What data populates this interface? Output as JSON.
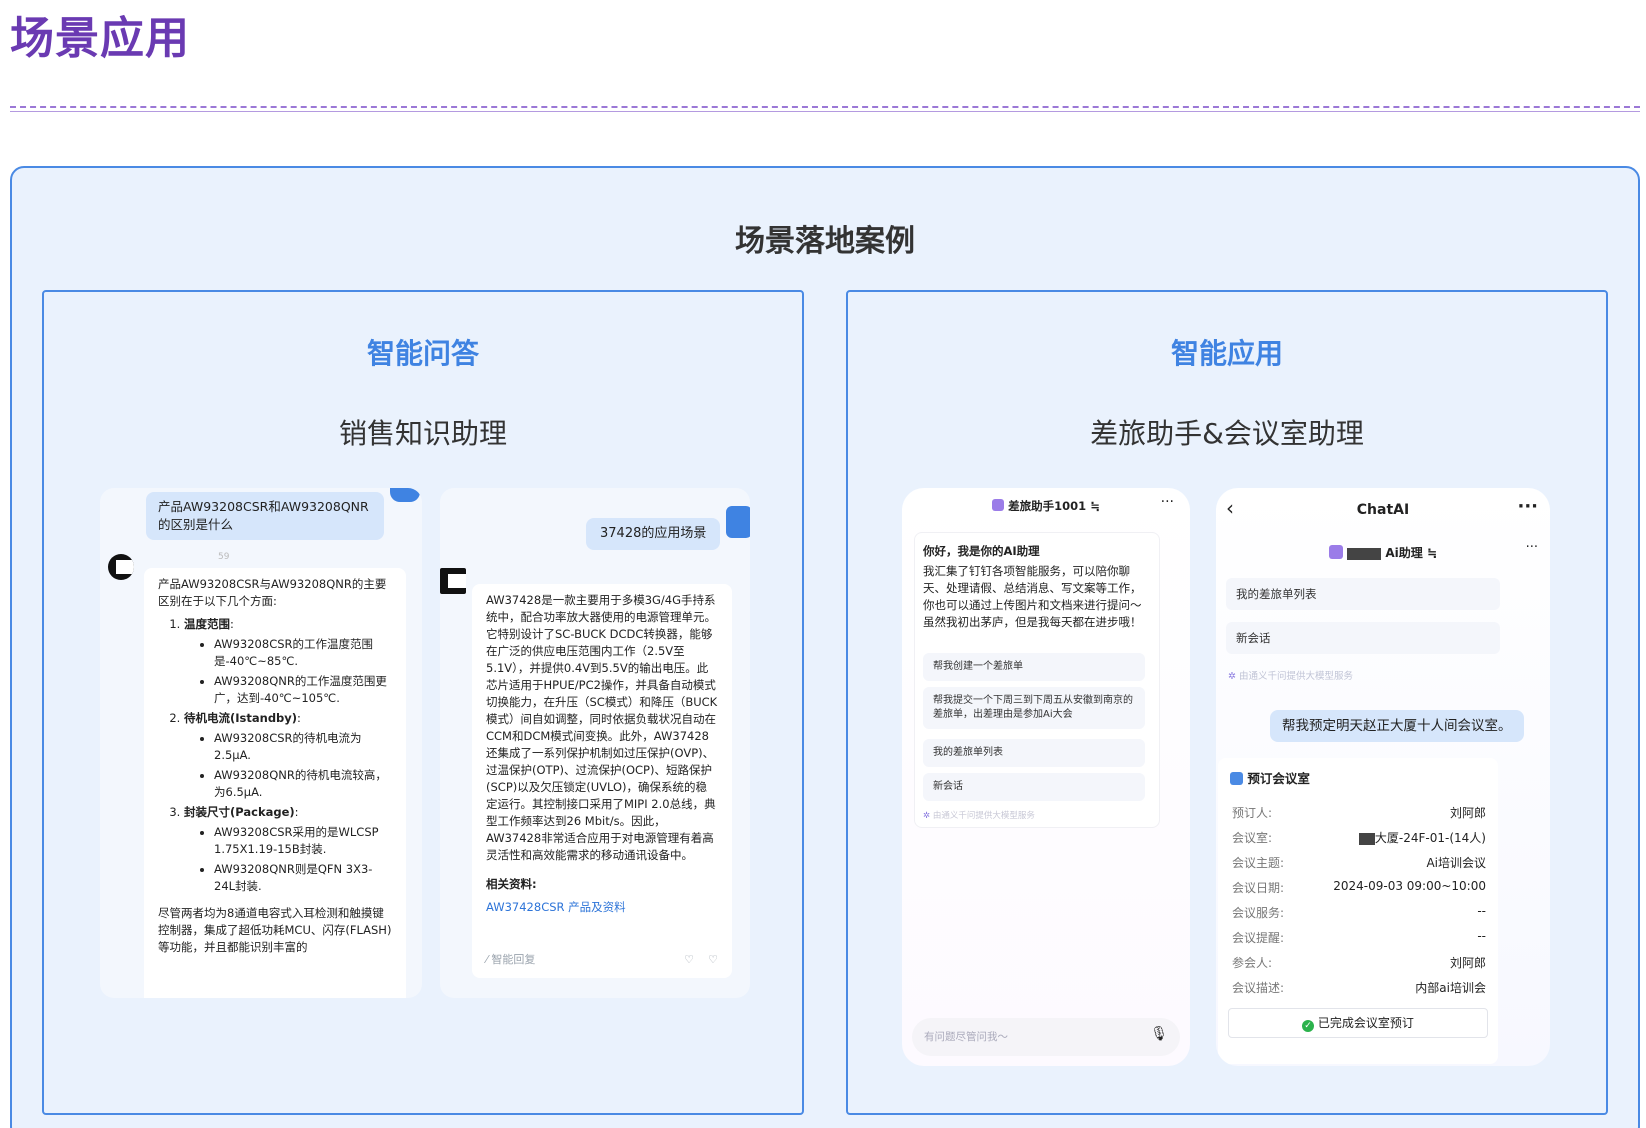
{
  "page": {
    "title": "场景应用"
  },
  "section": {
    "heading": "场景落地案例"
  },
  "cards": {
    "left": {
      "category": "智能问答",
      "subtitle": "销售知识助理",
      "shot1": {
        "question": "产品AW93208CSR和AW93208QNR的区别是什么",
        "sender_meta": "59",
        "answer_intro": "产品AW93208CSR与AW93208QNR的主要区别在于以下几个方面:",
        "points": [
          {
            "label": "温度范围",
            "items": [
              "AW93208CSR的工作温度范围是-40℃~85℃.",
              "AW93208QNR的工作温度范围更广，达到-40℃~105℃."
            ]
          },
          {
            "label": "待机电流(Istandby)",
            "items": [
              "AW93208CSR的待机电流为2.5μA.",
              "AW93208QNR的待机电流较高，为6.5μA."
            ]
          },
          {
            "label": "封装尺寸(Package)",
            "items": [
              "AW93208CSR采用的是WLCSP 1.75X1.19-15B封装.",
              "AW93208QNR则是QFN 3X3-24L封装."
            ]
          }
        ],
        "conclusion": "尽管两者均为8通道电容式入耳检测和触摸键控制器，集成了超低功耗MCU、闪存(FLASH)等功能，并且都能识别丰富的"
      },
      "shot2": {
        "question": "37428的应用场景",
        "answer": "AW37428是一款主要用于多模3G/4G手持系统中，配合功率放大器使用的电源管理单元。它特别设计了SC-BUCK DCDC转换器，能够在广泛的供应电压范围内工作（2.5V至5.1V），并提供0.4V到5.5V的输出电压。此芯片适用于HPUE/PC2操作，并具备自动模式切换能力，在升压（SC模式）和降压（BUCK模式）间自如调整，同时依据负载状况自动在CCM和DCM模式间变换。此外，AW37428还集成了一系列保护机制如过压保护(OVP)、过温保护(OTP)、过流保护(OCP)、短路保护(SCP)以及欠压锁定(UVLO)，确保系统的稳定运行。其控制接口采用了MIPI 2.0总线，典型工作频率达到26 Mbit/s。因此，AW37428非常适合应用于对电源管理有着高灵活性和高效能需求的移动通讯设备中。",
        "ref_label": "相关资料:",
        "ref_link": "AW37428CSR 产品及资料",
        "footer": "智能回复"
      }
    },
    "right": {
      "category": "智能应用",
      "subtitle": "差旅助手&会议室助理",
      "shot3": {
        "bot_name": "差旅助手1001",
        "greeting_title": "你好，我是你的AI助理",
        "greeting_body": "我汇集了钉钉各项智能服务，可以陪你聊天、处理请假、总结消息、写文案等工作，你也可以通过上传图片和文档来进行提问～虽然我初出茅庐，但是我每天都在进步哦！",
        "chips": [
          "帮我创建一个差旅单",
          "帮我提交一个下周三到下周五从安徽到南京的差旅单，出差理由是参加Ai大会",
          "我的差旅单列表",
          "新会话"
        ],
        "powered": "由通义千问提供大模型服务",
        "input_placeholder": "有问题尽管问我～"
      },
      "shot4": {
        "nav_title": "ChatAI",
        "bot_name": "Ai助理",
        "chips": [
          "我的差旅单列表",
          "新会话"
        ],
        "powered": "由通义千问提供大模型服务",
        "user_msg": "帮我预定明天赵正大厦十人间会议室。",
        "card_title": "预订会议室",
        "fields": [
          {
            "k": "预订人:",
            "v": "刘阿郎"
          },
          {
            "k": "会议室:",
            "v": "大厦-24F-01-(14人)"
          },
          {
            "k": "会议主题:",
            "v": "Ai培训会议"
          },
          {
            "k": "会议日期:",
            "v": "2024-09-03 09:00~10:00"
          },
          {
            "k": "会议服务:",
            "v": "--"
          },
          {
            "k": "会议提醒:",
            "v": "--"
          },
          {
            "k": "参会人:",
            "v": "刘阿郎"
          },
          {
            "k": "会议描述:",
            "v": "内部ai培训会"
          }
        ],
        "done": "已完成会议室预订"
      }
    }
  }
}
